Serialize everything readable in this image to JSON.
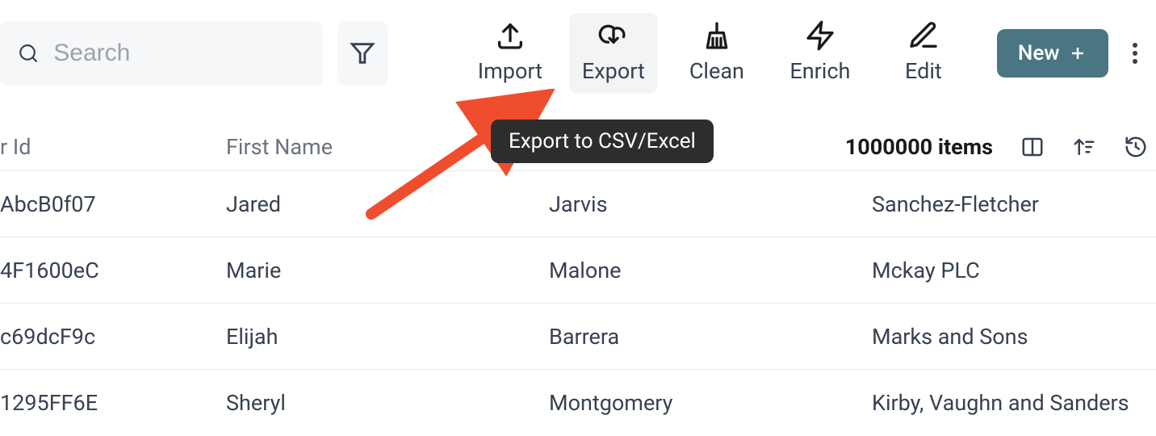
{
  "toolbar": {
    "search_placeholder": "Search",
    "import_label": "Import",
    "export_label": "Export",
    "clean_label": "Clean",
    "enrich_label": "Enrich",
    "edit_label": "Edit",
    "new_label": "New"
  },
  "tooltip": "Export to CSV/Excel",
  "table": {
    "columns": {
      "id": "r Id",
      "first_name": "First Name"
    },
    "item_count": "1000000 items",
    "rows": [
      {
        "id": "AbcB0f07",
        "first_name": "Jared",
        "last_name": "Jarvis",
        "company": "Sanchez-Fletcher"
      },
      {
        "id": "4F1600eC",
        "first_name": "Marie",
        "last_name": "Malone",
        "company": "Mckay PLC"
      },
      {
        "id": "c69dcF9c",
        "first_name": "Elijah",
        "last_name": "Barrera",
        "company": "Marks and Sons"
      },
      {
        "id": "1295FF6E",
        "first_name": "Sheryl",
        "last_name": "Montgomery",
        "company": "Kirby, Vaughn and Sanders"
      }
    ]
  },
  "colors": {
    "accent": "#4a7583",
    "arrow": "#f04d2f"
  }
}
